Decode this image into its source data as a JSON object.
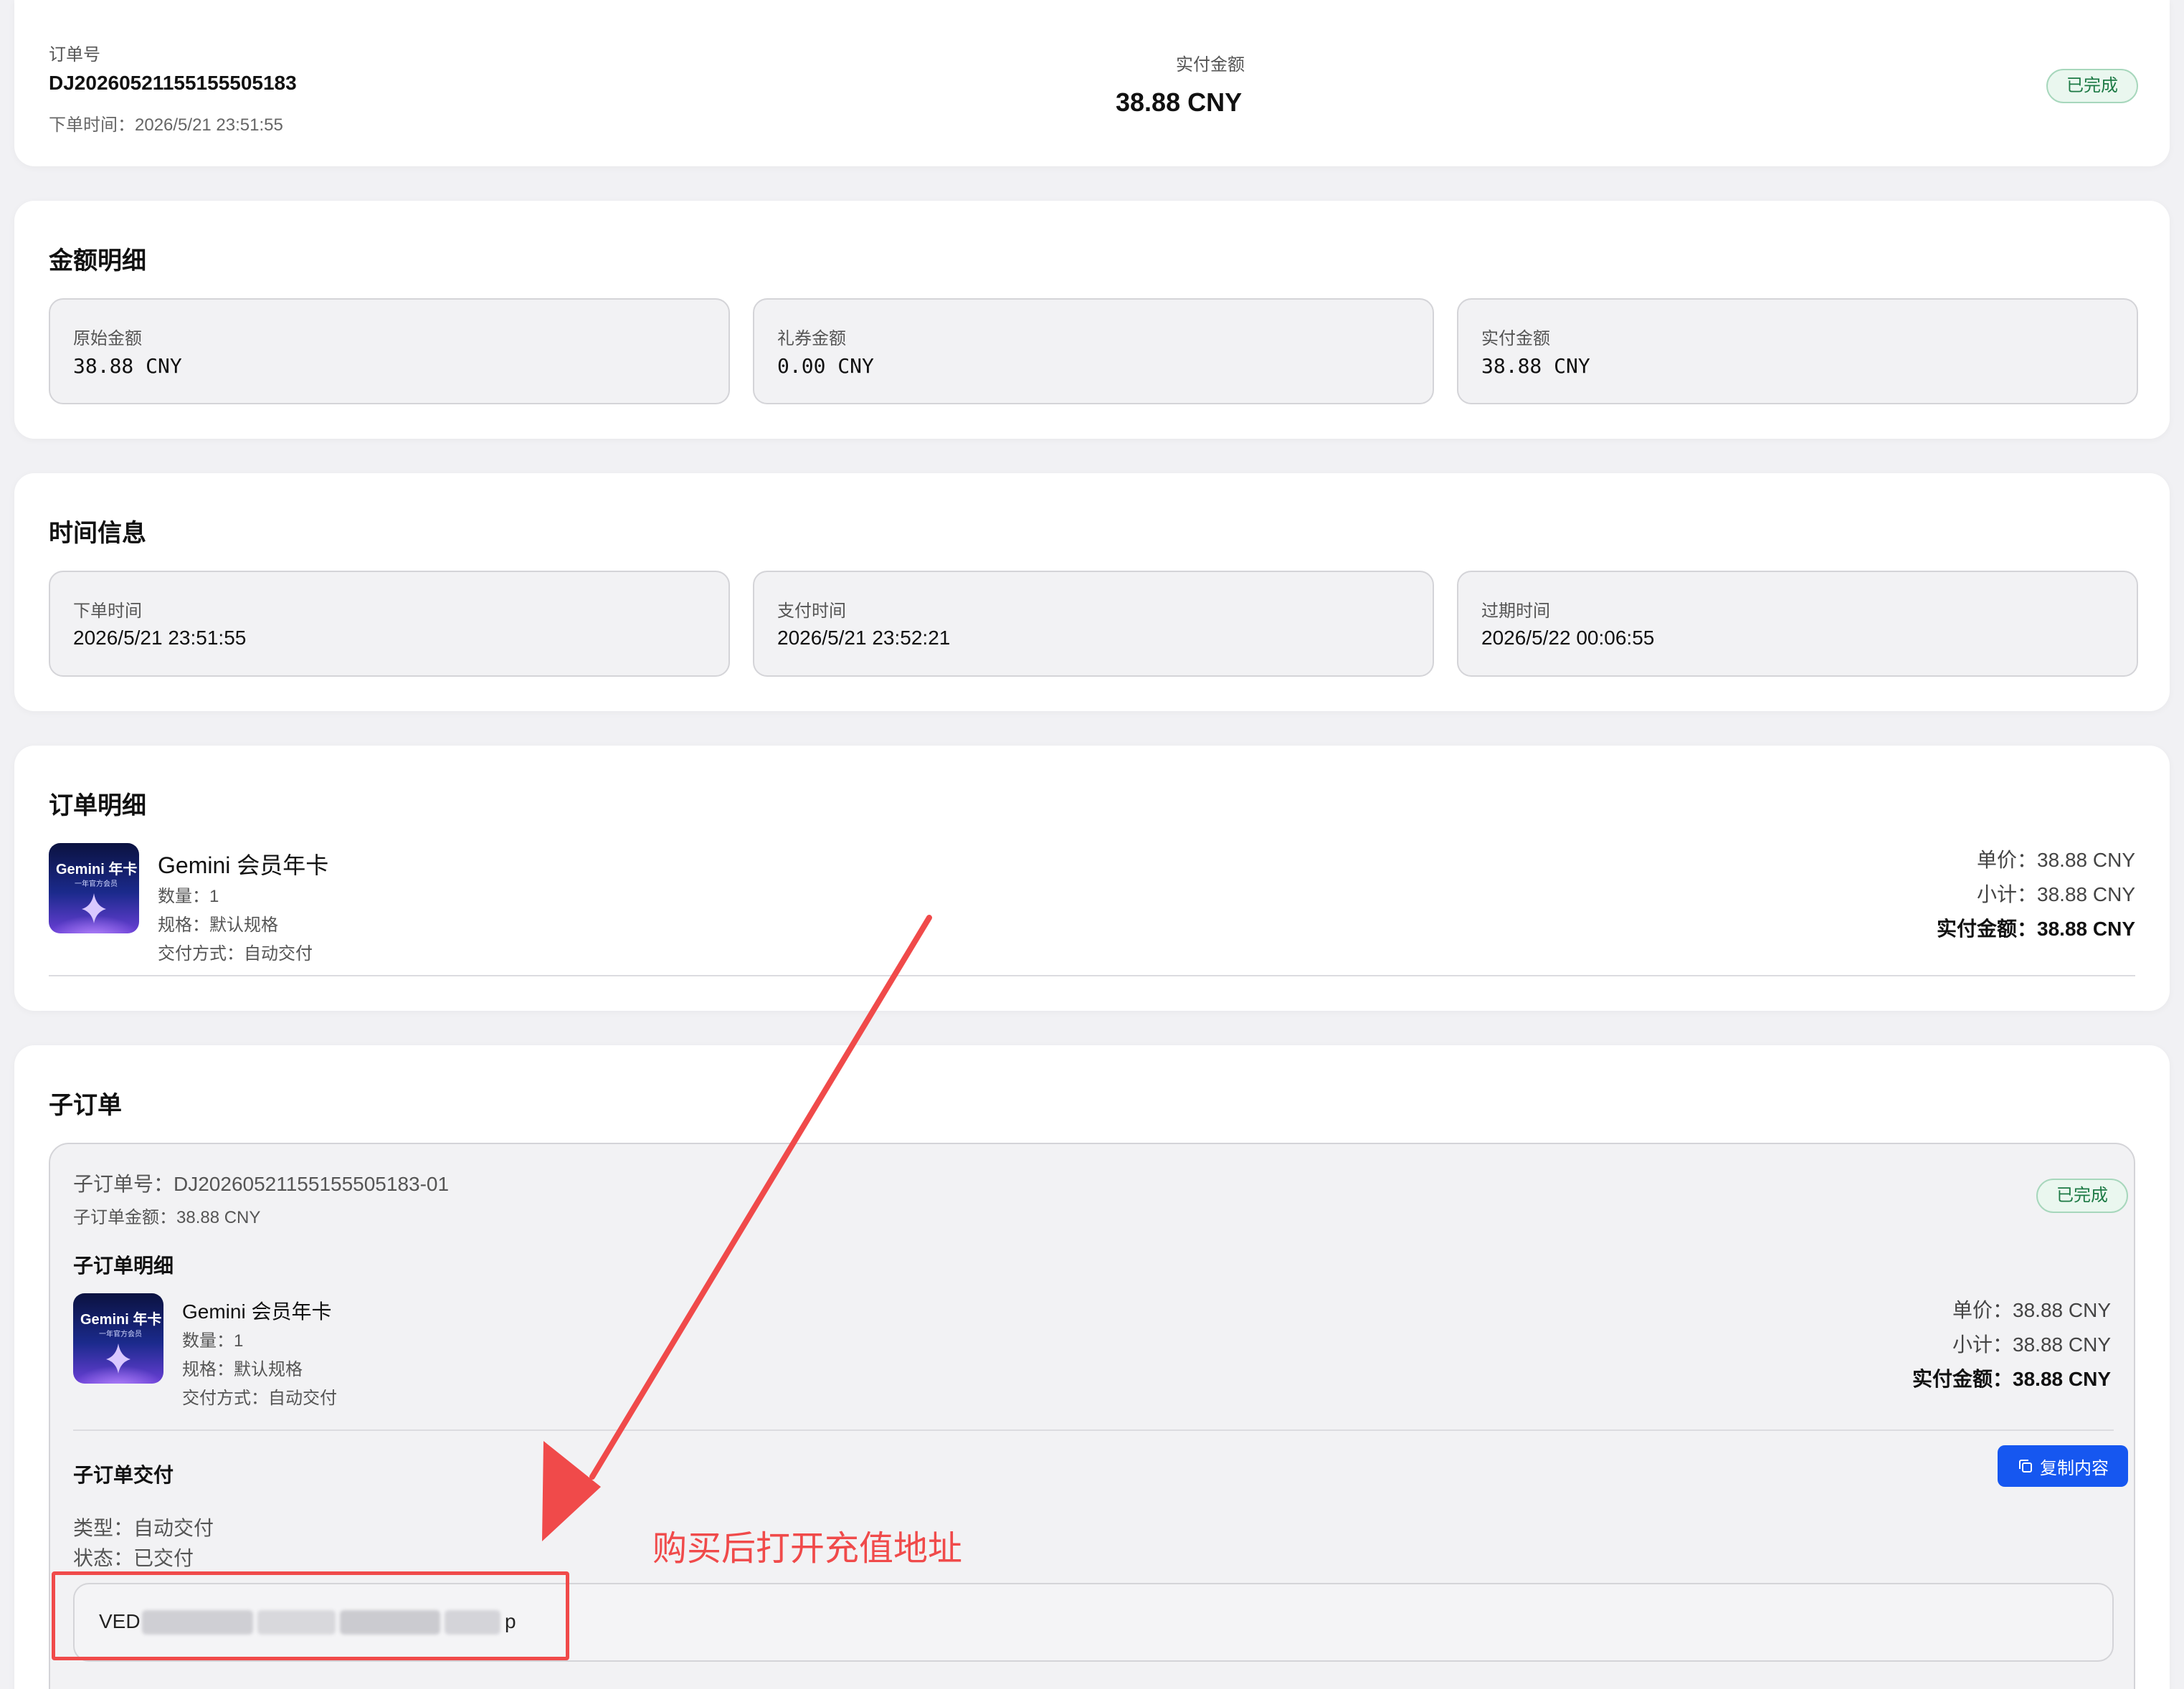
{
  "summary": {
    "order_no_label": "订单号",
    "order_no": "DJ20260521155155505183",
    "order_time": "下单时间：2026/5/21 23:51:55",
    "paid_label": "实付金额",
    "paid_value": "38.88 CNY",
    "status": "已完成"
  },
  "amount": {
    "title": "金额明细",
    "items": [
      {
        "label": "原始金额",
        "value": "38.88 CNY"
      },
      {
        "label": "礼券金额",
        "value": "0.00 CNY"
      },
      {
        "label": "实付金额",
        "value": "38.88 CNY"
      }
    ]
  },
  "time": {
    "title": "时间信息",
    "items": [
      {
        "label": "下单时间",
        "value": "2026/5/21 23:51:55"
      },
      {
        "label": "支付时间",
        "value": "2026/5/21 23:52:21"
      },
      {
        "label": "过期时间",
        "value": "2026/5/22 00:06:55"
      }
    ]
  },
  "detail": {
    "title": "订单明细",
    "product": {
      "thumb_title": "Gemini 年卡",
      "thumb_sub": "一年官方会员",
      "name": "Gemini 会员年卡",
      "qty": "数量：1",
      "spec": "规格：默认规格",
      "delivery": "交付方式：自动交付"
    },
    "unit_price": "单价：38.88 CNY",
    "subtotal": "小计：38.88 CNY",
    "paid": "实付金额：38.88 CNY"
  },
  "suborder": {
    "title": "子订单",
    "no": "子订单号：DJ20260521155155505183-01",
    "amount": "子订单金额：38.88 CNY",
    "status": "已完成",
    "detail_title": "子订单明细",
    "product": {
      "thumb_title": "Gemini 年卡",
      "thumb_sub": "一年官方会员",
      "name": "Gemini 会员年卡",
      "qty": "数量：1",
      "spec": "规格：默认规格",
      "delivery": "交付方式：自动交付"
    },
    "unit_price": "单价：38.88 CNY",
    "subtotal": "小计：38.88 CNY",
    "paid": "实付金额：38.88 CNY",
    "delivery_title": "子订单交付",
    "copy_button": "复制内容",
    "type": "类型：自动交付",
    "state": "状态：已交付",
    "content_start": "VED",
    "content_end": "p"
  },
  "annotation": {
    "text": "购买后打开充值地址",
    "color": "#f04a4a"
  }
}
